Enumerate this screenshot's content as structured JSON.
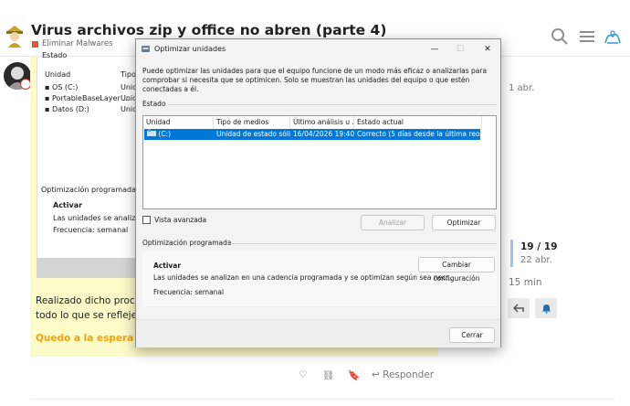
{
  "header": {
    "title": "Virus archivos zip y office no abren (parte 4)",
    "category": "Eliminar Malwares",
    "colors": {
      "category": "#e45735"
    }
  },
  "screenshot_in_post": {
    "estado_label": "Estado",
    "columns": [
      "Unidad",
      "Tipo"
    ],
    "drives": [
      {
        "name": "OS (C:)",
        "type": "Unid"
      },
      {
        "name": "PortableBaseLayer ...",
        "type": "Unid"
      },
      {
        "name": "Datos (D:)",
        "type": "Unid"
      }
    ],
    "sched_label": "Optimización programada",
    "activar": "Activar",
    "desc": "Las unidades se analizan en",
    "freq": "Frecuencia: semanal"
  },
  "post": {
    "line1": "Realizado dicho procedim",
    "line2": "todo lo que se refleje.",
    "orange": "Quedo a la espera de s",
    "reply": "Responder"
  },
  "timeline": {
    "start_date": "1 abr.",
    "count": "19 / 19",
    "current_date": "22 abr.",
    "ago": "15 min"
  },
  "dialog": {
    "title": "Optimizar unidades",
    "description": "Puede optimizar las unidades para que el equipo funcione de un modo más eficaz o analizarlas para comprobar si necesita que se optimicen. Solo se muestran las unidades del equipo o que estén conectadas a él.",
    "estado_label": "Estado",
    "columns": {
      "unidad": "Unidad",
      "tipo": "Tipo de medios",
      "ultimo": "Último análisis u ...",
      "estado": "Estado actual"
    },
    "row": {
      "unidad": "(C:)",
      "tipo": "Unidad de estado sóli...",
      "ultimo": "16/04/2026 19:40",
      "estado": "Correcto (5 días desde la última reopti..."
    },
    "vista_avanzada": "Vista avanzada",
    "analizar": "Analizar",
    "optimizar": "Optimizar",
    "sched_label": "Optimización programada",
    "activar": "Activar",
    "sched_desc": "Las unidades se analizan en una cadencia programada y se optimizan según sea nec...",
    "frecuencia": "Frecuencia: semanal",
    "cambiar": "Cambiar configuración",
    "cerrar": "Cerrar",
    "colors": {
      "selection": "#0078d7"
    }
  }
}
